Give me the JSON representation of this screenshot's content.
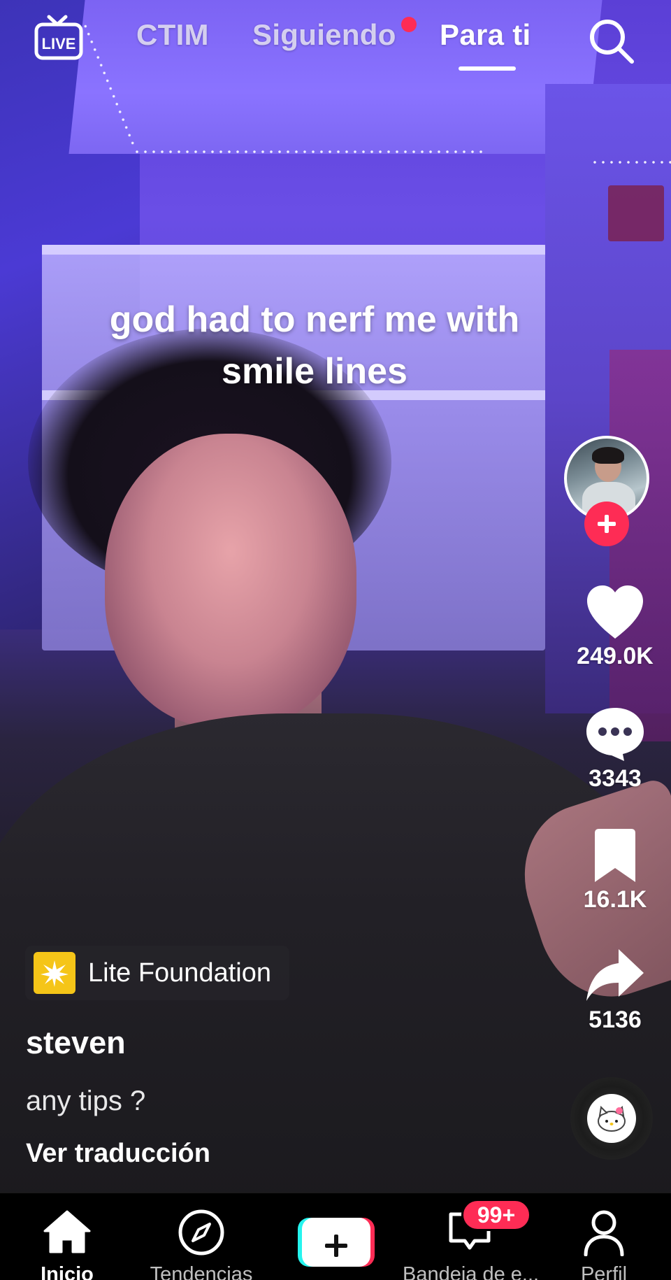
{
  "top_nav": {
    "live_label": "LIVE",
    "tabs": [
      {
        "label": "CTIM"
      },
      {
        "label": "Siguiendo"
      },
      {
        "label": "Para ti"
      }
    ]
  },
  "video": {
    "overlay_text_line1": "god had to nerf me with",
    "overlay_text_line2": "smile lines"
  },
  "actions": {
    "likes": "249.0K",
    "comments": "3343",
    "saves": "16.1K",
    "shares": "5136"
  },
  "post": {
    "promo_label": "Lite Foundation",
    "username": "steven",
    "description": "any tips ?",
    "translate_label": "Ver traducción"
  },
  "bottom_nav": {
    "items": [
      {
        "label": "Inicio"
      },
      {
        "label": "Tendencias"
      },
      {
        "label": ""
      },
      {
        "label": "Bandeja de e..."
      },
      {
        "label": "Perfil"
      }
    ],
    "inbox_badge": "99+"
  },
  "colors": {
    "accent_red": "#fe2c55",
    "accent_cyan": "#25f4ee",
    "promo_yellow": "#f5c518"
  }
}
